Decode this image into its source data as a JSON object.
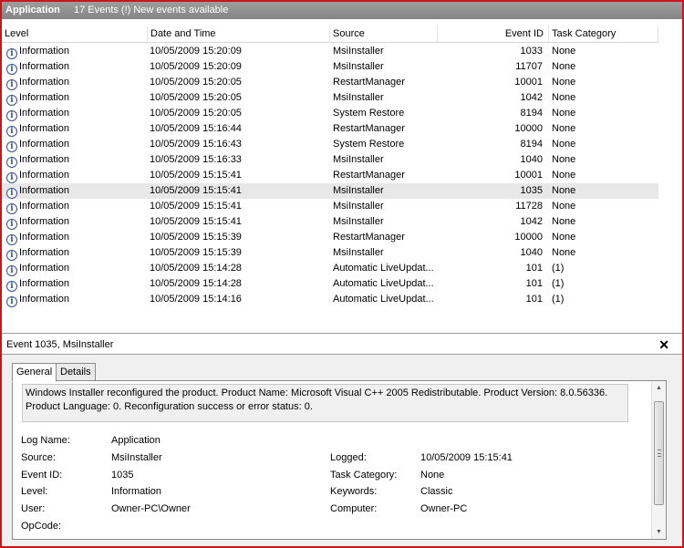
{
  "titlebar": {
    "app_name": "Application",
    "event_summary": "17 Events (!) New events available"
  },
  "columns": {
    "level": "Level",
    "date_time": "Date and Time",
    "source": "Source",
    "event_id": "Event ID",
    "task_category": "Task Category"
  },
  "events": [
    {
      "level": "Information",
      "date_time": "10/05/2009 15:20:09",
      "source": "MsiInstaller",
      "event_id": "1033",
      "task_category": "None"
    },
    {
      "level": "Information",
      "date_time": "10/05/2009 15:20:09",
      "source": "MsiInstaller",
      "event_id": "11707",
      "task_category": "None"
    },
    {
      "level": "Information",
      "date_time": "10/05/2009 15:20:05",
      "source": "RestartManager",
      "event_id": "10001",
      "task_category": "None"
    },
    {
      "level": "Information",
      "date_time": "10/05/2009 15:20:05",
      "source": "MsiInstaller",
      "event_id": "1042",
      "task_category": "None"
    },
    {
      "level": "Information",
      "date_time": "10/05/2009 15:20:05",
      "source": "System Restore",
      "event_id": "8194",
      "task_category": "None"
    },
    {
      "level": "Information",
      "date_time": "10/05/2009 15:16:44",
      "source": "RestartManager",
      "event_id": "10000",
      "task_category": "None"
    },
    {
      "level": "Information",
      "date_time": "10/05/2009 15:16:43",
      "source": "System Restore",
      "event_id": "8194",
      "task_category": "None"
    },
    {
      "level": "Information",
      "date_time": "10/05/2009 15:16:33",
      "source": "MsiInstaller",
      "event_id": "1040",
      "task_category": "None"
    },
    {
      "level": "Information",
      "date_time": "10/05/2009 15:15:41",
      "source": "RestartManager",
      "event_id": "10001",
      "task_category": "None"
    },
    {
      "level": "Information",
      "date_time": "10/05/2009 15:15:41",
      "source": "MsiInstaller",
      "event_id": "1035",
      "task_category": "None",
      "selected": true
    },
    {
      "level": "Information",
      "date_time": "10/05/2009 15:15:41",
      "source": "MsiInstaller",
      "event_id": "11728",
      "task_category": "None"
    },
    {
      "level": "Information",
      "date_time": "10/05/2009 15:15:41",
      "source": "MsiInstaller",
      "event_id": "1042",
      "task_category": "None"
    },
    {
      "level": "Information",
      "date_time": "10/05/2009 15:15:39",
      "source": "RestartManager",
      "event_id": "10000",
      "task_category": "None"
    },
    {
      "level": "Information",
      "date_time": "10/05/2009 15:15:39",
      "source": "MsiInstaller",
      "event_id": "1040",
      "task_category": "None"
    },
    {
      "level": "Information",
      "date_time": "10/05/2009 15:14:28",
      "source": "Automatic LiveUpdat...",
      "event_id": "101",
      "task_category": "(1)"
    },
    {
      "level": "Information",
      "date_time": "10/05/2009 15:14:28",
      "source": "Automatic LiveUpdat...",
      "event_id": "101",
      "task_category": "(1)"
    },
    {
      "level": "Information",
      "date_time": "10/05/2009 15:14:16",
      "source": "Automatic LiveUpdat...",
      "event_id": "101",
      "task_category": "(1)"
    }
  ],
  "details": {
    "header": "Event 1035, MsiInstaller",
    "tabs": {
      "general": "General",
      "details": "Details"
    },
    "message": "Windows Installer reconfigured the product. Product Name: Microsoft Visual C++ 2005 Redistributable. Product Version: 8.0.56336. Product Language: 0. Reconfiguration success or error status: 0.",
    "labels": {
      "log_name": "Log Name:",
      "source": "Source:",
      "event_id": "Event ID:",
      "level": "Level:",
      "user": "User:",
      "opcode": "OpCode:",
      "logged": "Logged:",
      "task_category": "Task Category:",
      "keywords": "Keywords:",
      "computer": "Computer:"
    },
    "values": {
      "log_name": "Application",
      "source": "MsiInstaller",
      "event_id": "1035",
      "level": "Information",
      "user": "Owner-PC\\Owner",
      "opcode": "",
      "logged": "10/05/2009 15:15:41",
      "task_category": "None",
      "keywords": "Classic",
      "computer": "Owner-PC"
    }
  },
  "icons": {
    "info": "information-icon",
    "close": "close-icon"
  },
  "colors": {
    "frame_border": "#c8161d",
    "titlebar": "#8f8f8f",
    "selected_row": "#e8e8e8",
    "info_icon": "#35538f"
  }
}
